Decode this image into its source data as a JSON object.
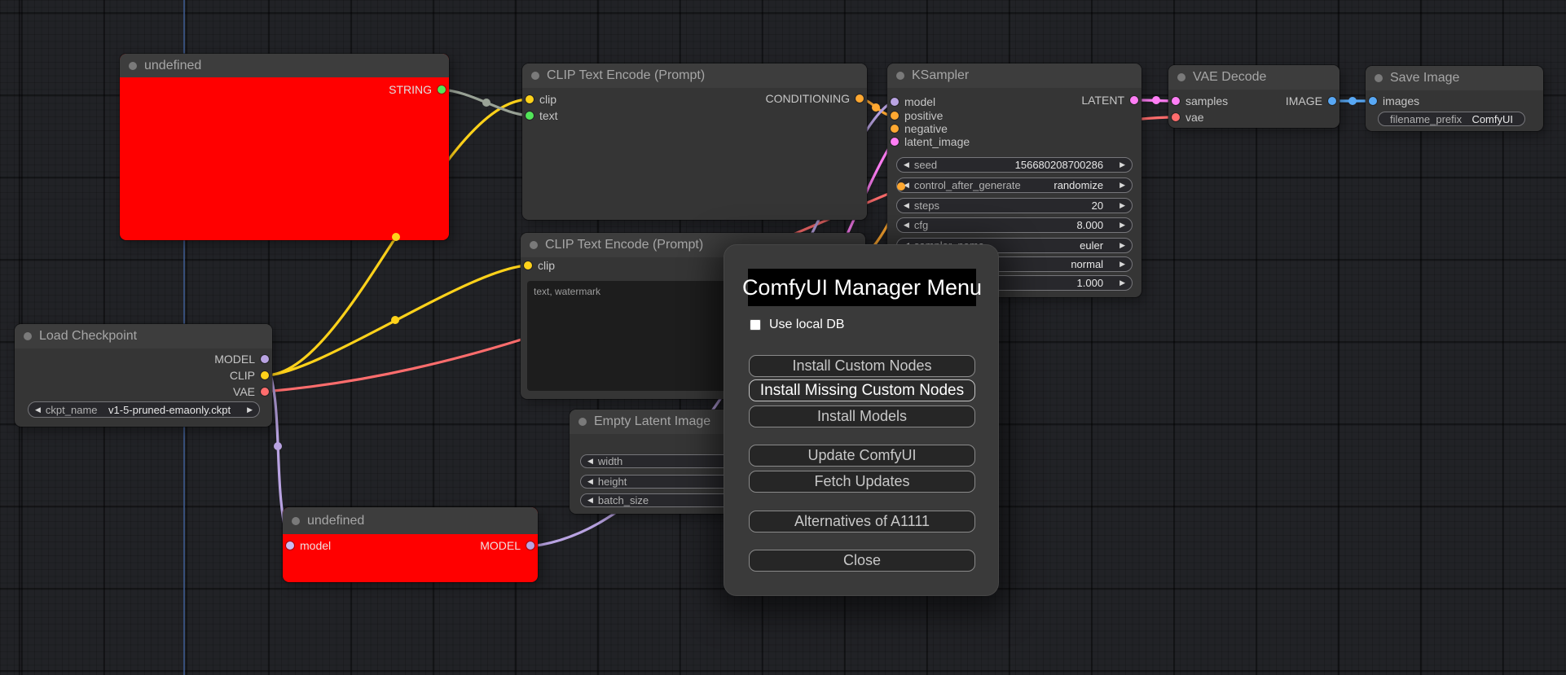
{
  "icons": {
    "left_arrow": "◀",
    "right_arrow": "▶"
  },
  "colors": {
    "canvas_bg": "#212226",
    "axis_line": "#3d5a8f",
    "error_node_body": "#ff0000",
    "link_clip": "#ffd21a",
    "link_model": "#b9a3e2",
    "link_vae": "#ff6d6d",
    "link_conditioning": "#ffa831",
    "link_latent": "#ff7ef5",
    "link_image": "#58a8f5",
    "link_string_wire": "#99a296",
    "port_string": "#52e559"
  },
  "nodes": {
    "undefined_top": {
      "title": "undefined",
      "output_label": "STRING"
    },
    "clip_encode_1": {
      "title": "CLIP Text Encode (Prompt)",
      "inputs": [
        "clip",
        "text"
      ],
      "output_label": "CONDITIONING"
    },
    "clip_encode_2": {
      "title": "CLIP Text Encode (Prompt)",
      "inputs": [
        "clip"
      ],
      "text_value": "text, watermark"
    },
    "ksampler": {
      "title": "KSampler",
      "inputs": [
        "model",
        "positive",
        "negative",
        "latent_image"
      ],
      "output_label": "LATENT",
      "widgets": [
        {
          "label": "seed",
          "value": "156680208700286"
        },
        {
          "label": "control_after_generate",
          "value": "randomize"
        },
        {
          "label": "steps",
          "value": "20"
        },
        {
          "label": "cfg",
          "value": "8.000"
        },
        {
          "label": "sampler_name",
          "value": "euler"
        },
        {
          "label": "",
          "value": "normal"
        },
        {
          "label": "",
          "value": "1.000"
        }
      ]
    },
    "vae_decode": {
      "title": "VAE Decode",
      "inputs": [
        "samples",
        "vae"
      ],
      "output_label": "IMAGE"
    },
    "save_image": {
      "title": "Save Image",
      "inputs": [
        "images"
      ],
      "widget": {
        "label": "filename_prefix",
        "value": "ComfyUI"
      }
    },
    "load_checkpoint": {
      "title": "Load Checkpoint",
      "outputs": [
        "MODEL",
        "CLIP",
        "VAE"
      ],
      "widget": {
        "label": "ckpt_name",
        "value": "v1-5-pruned-emaonly.ckpt"
      }
    },
    "empty_latent": {
      "title": "Empty Latent Image",
      "widgets": [
        {
          "label": "width"
        },
        {
          "label": "height"
        },
        {
          "label": "batch_size"
        }
      ]
    },
    "undefined_bottom": {
      "title": "undefined",
      "inputs": [
        "model"
      ],
      "output_label": "MODEL"
    }
  },
  "dialog": {
    "title": "ComfyUI Manager Menu",
    "checkbox_label": "Use local DB",
    "checkbox_checked": false,
    "buttons": [
      "Install Custom Nodes",
      "Install Missing Custom Nodes",
      "Install Models",
      "Update ComfyUI",
      "Fetch Updates",
      "Alternatives of A1111",
      "Close"
    ]
  }
}
